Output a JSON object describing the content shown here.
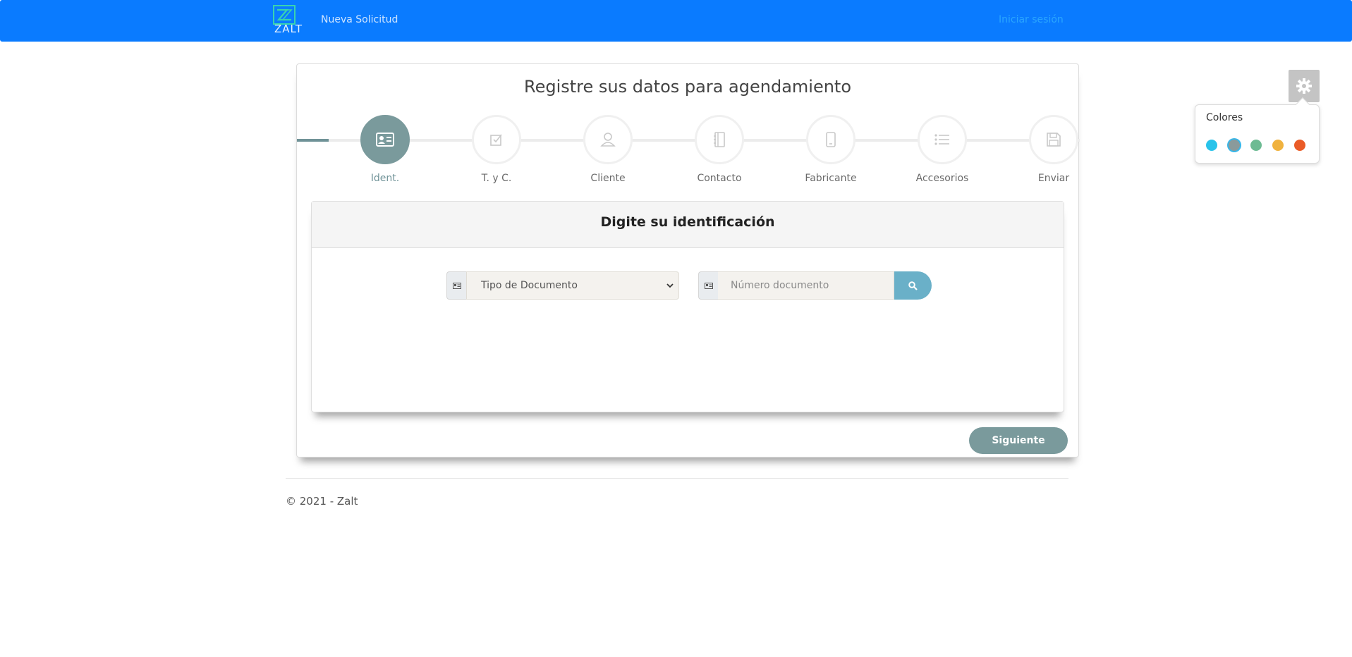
{
  "navbar": {
    "brand": "ZALT",
    "nav_link": "Nueva Solicitud",
    "login": "Iniciar sesión",
    "color": "#0a7bff"
  },
  "card": {
    "title": "Registre sus datos para agendamiento"
  },
  "steps": [
    {
      "label": "Ident.",
      "icon": "id-card-icon",
      "active": true
    },
    {
      "label": "T. y C.",
      "icon": "checkbox-icon",
      "active": false
    },
    {
      "label": "Cliente",
      "icon": "user-icon",
      "active": false
    },
    {
      "label": "Contacto",
      "icon": "address-book-icon",
      "active": false
    },
    {
      "label": "Fabricante",
      "icon": "mobile-icon",
      "active": false
    },
    {
      "label": "Accesorios",
      "icon": "list-icon",
      "active": false
    },
    {
      "label": "Enviar",
      "icon": "save-icon",
      "active": false
    }
  ],
  "panel": {
    "title": "Digite su identificación",
    "doc_type_select": {
      "selected": "Tipo de Documento"
    },
    "doc_number_input": {
      "placeholder": "Número documento",
      "value": ""
    }
  },
  "actions": {
    "next": "Siguiente"
  },
  "footer": {
    "copyright": "© 2021 - Zalt"
  },
  "color_widget": {
    "title": "Colores",
    "swatches": [
      "#29c3ea",
      "#8a9a9b",
      "#6dbb93",
      "#f0b23e",
      "#ea5b27"
    ],
    "selected_index": 1
  },
  "accent_color": "#7a9a9c"
}
